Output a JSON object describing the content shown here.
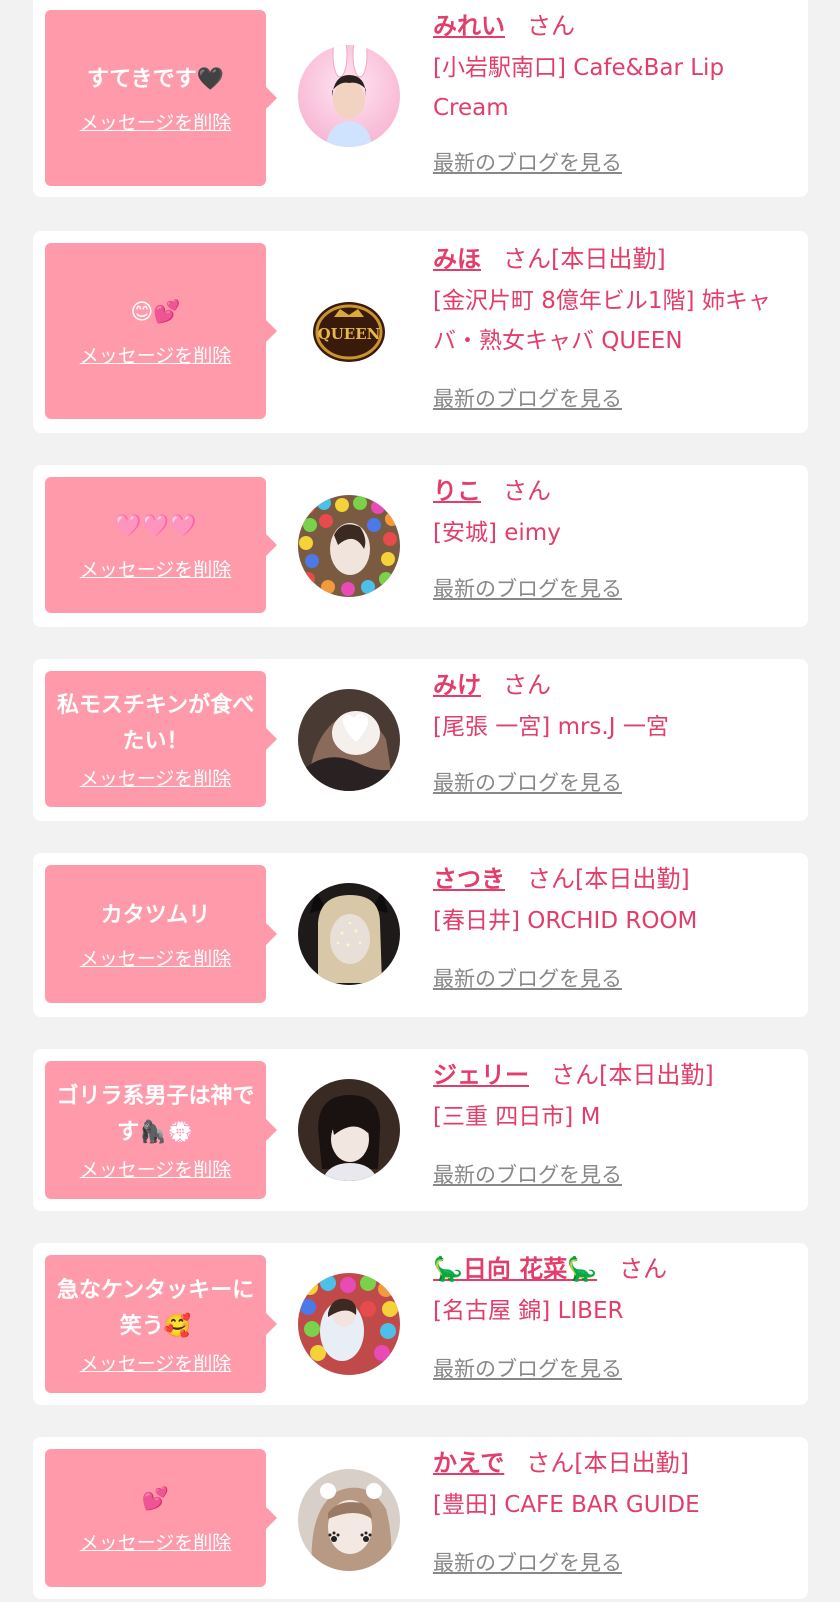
{
  "cards": [
    {
      "message": "すてきです🖤",
      "delete_label": "メッセージを削除",
      "name": "みれい",
      "suffix": "さん",
      "shop": "[小岩駅南口] Cafe&Bar Lip Cream",
      "blog_label": "最新のブログを見る"
    },
    {
      "message": "😊💕",
      "delete_label": "メッセージを削除",
      "name": "みほ",
      "suffix": "さん[本日出勤]",
      "shop": "[金沢片町 8億年ビル1階] 姉キャバ・熟女キャバ QUEEN",
      "blog_label": "最新のブログを見る"
    },
    {
      "message": "🩷🩷🩷",
      "delete_label": "メッセージを削除",
      "name": "りこ",
      "suffix": "さん",
      "shop": "[安城] eimy",
      "blog_label": "最新のブログを見る"
    },
    {
      "message": "私モスチキンが食べたい！",
      "delete_label": "メッセージを削除",
      "name": "みけ",
      "suffix": "さん",
      "shop": "[尾張 一宮] mrs.J 一宮",
      "blog_label": "最新のブログを見る"
    },
    {
      "message": "カタツムリ",
      "delete_label": "メッセージを削除",
      "name": "さつき",
      "suffix": "さん[本日出勤]",
      "shop": "[春日井] ORCHID ROOM",
      "blog_label": "最新のブログを見る"
    },
    {
      "message": "ゴリラ系男子は神です🦍💮",
      "delete_label": "メッセージを削除",
      "name": "ジェリー",
      "suffix": "さん[本日出勤]",
      "shop": "[三重 四日市] M",
      "blog_label": "最新のブログを見る"
    },
    {
      "message": "急なケンタッキーに笑う🥰",
      "delete_label": "メッセージを削除",
      "name": "🦕日向 花菜🦕",
      "suffix": "さん",
      "shop": "[名古屋 錦] LIBER",
      "blog_label": "最新のブログを見る"
    },
    {
      "message": "💕",
      "delete_label": "メッセージを削除",
      "name": "かえで",
      "suffix": "さん[本日出勤]",
      "shop": "[豊田] CAFE BAR GUIDE",
      "blog_label": "最新のブログを見る"
    }
  ],
  "colors": {
    "accent": "#e23d6b",
    "bubble": "#ff9aab",
    "background": "#f2f2f2",
    "link_gray": "#888888"
  }
}
